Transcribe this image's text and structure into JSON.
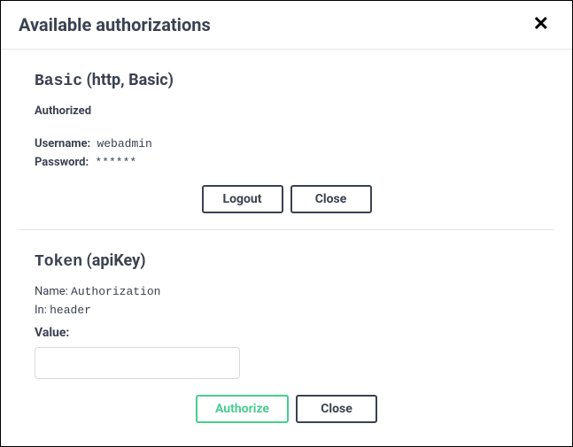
{
  "modal": {
    "title": "Available authorizations"
  },
  "basic": {
    "name": "Basic",
    "scheme": "(http, Basic)",
    "status": "Authorized",
    "username_label": "Username:",
    "username_value": "webadmin",
    "password_label": "Password:",
    "password_value": "******",
    "logout_label": "Logout",
    "close_label": "Close"
  },
  "token": {
    "name": "Token",
    "scheme": "(apiKey)",
    "name_label": "Name:",
    "name_value": "Authorization",
    "in_label": "In:",
    "in_value": "header",
    "value_label": "Value:",
    "value": "",
    "authorize_label": "Authorize",
    "close_label": "Close"
  }
}
